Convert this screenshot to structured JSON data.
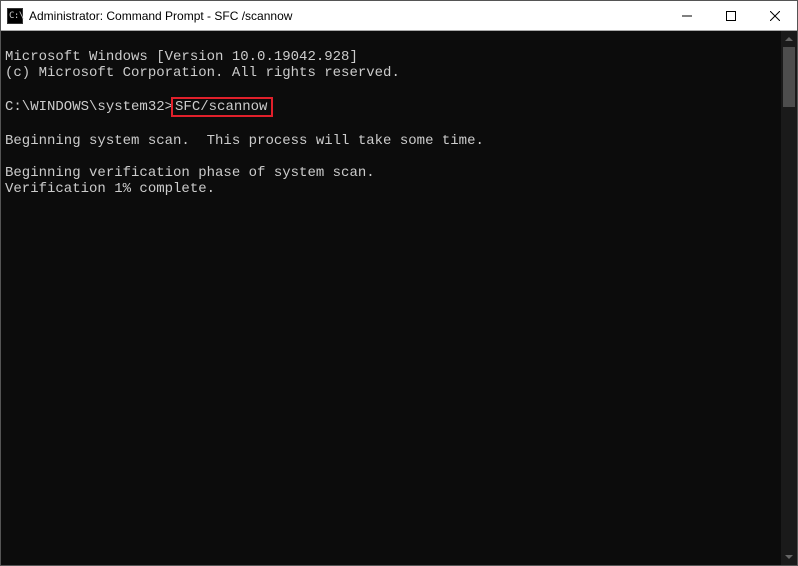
{
  "titlebar": {
    "icon_label": "C:\\",
    "title": "Administrator: Command Prompt - SFC /scannow"
  },
  "terminal": {
    "line1": "Microsoft Windows [Version 10.0.19042.928]",
    "line2": "(c) Microsoft Corporation. All rights reserved.",
    "blank1": "",
    "prompt_path": "C:\\WINDOWS\\system32>",
    "prompt_cmd": "SFC/scannow",
    "blank2": "",
    "line3": "Beginning system scan.  This process will take some time.",
    "blank3": "",
    "line4": "Beginning verification phase of system scan.",
    "line5": "Verification 1% complete."
  }
}
